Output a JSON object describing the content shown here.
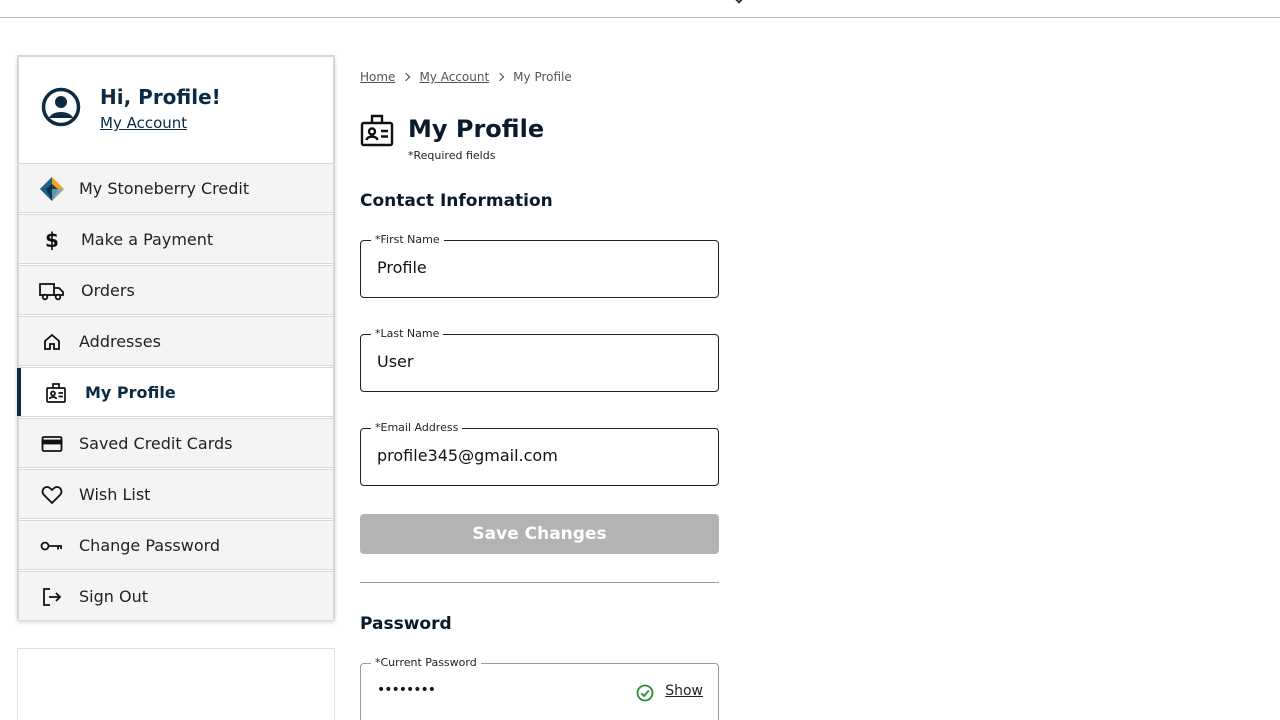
{
  "sidebar": {
    "greeting": "Hi, Profile!",
    "account_link": "My Account",
    "items": [
      {
        "label": "My Stoneberry Credit",
        "icon": "stoneberry-logo-icon"
      },
      {
        "label": "Make a Payment",
        "icon": "dollar-icon"
      },
      {
        "label": "Orders",
        "icon": "truck-icon"
      },
      {
        "label": "Addresses",
        "icon": "home-icon"
      },
      {
        "label": "My Profile",
        "icon": "id-badge-icon",
        "active": true
      },
      {
        "label": "Saved Credit Cards",
        "icon": "credit-card-icon"
      },
      {
        "label": "Wish List",
        "icon": "heart-icon"
      },
      {
        "label": "Change Password",
        "icon": "key-icon"
      },
      {
        "label": "Sign Out",
        "icon": "sign-out-icon"
      }
    ]
  },
  "breadcrumb": [
    "Home",
    "My Account",
    "My Profile"
  ],
  "page": {
    "title": "My Profile",
    "required_note": "*Required fields"
  },
  "contact": {
    "heading": "Contact Information",
    "first_name_label": "*First Name",
    "first_name_value": "Profile",
    "last_name_label": "*Last Name",
    "last_name_value": "User",
    "email_label": "*Email Address",
    "email_value": "profile345@gmail.com",
    "save_label": "Save Changes"
  },
  "password": {
    "heading": "Password",
    "current_label": "*Current Password",
    "current_value": "••••••••",
    "show_label": "Show"
  },
  "colors": {
    "brand_navy": "#0b2a44",
    "button_disabled": "#b3b3b3",
    "valid_green": "#2e8b3a"
  }
}
